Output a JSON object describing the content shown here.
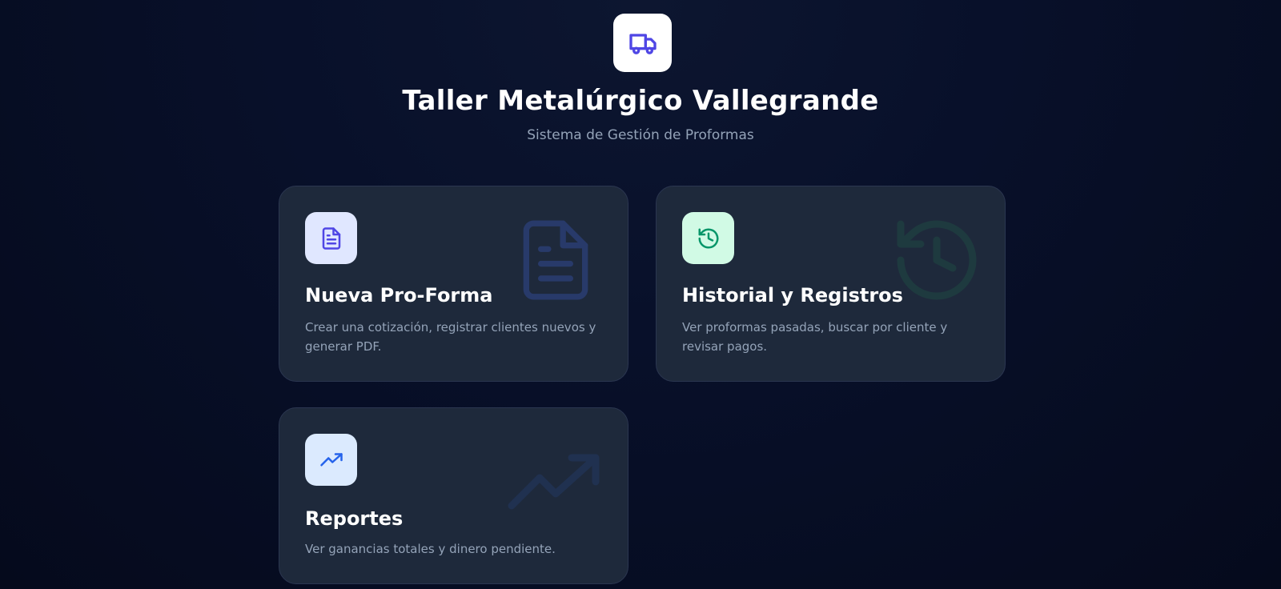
{
  "header": {
    "logo_icon": "truck-icon",
    "title": "Taller Metalúrgico Vallegrande",
    "subtitle": "Sistema de Gestión de Proformas"
  },
  "cards": [
    {
      "title": "Nueva Pro-Forma",
      "description": "Crear una cotización, registrar clientes nuevos y generar PDF.",
      "icon": "file-text-icon",
      "accent": "#4f46e5"
    },
    {
      "title": "Historial y Registros",
      "description": "Ver proformas pasadas, buscar por cliente y revisar pagos.",
      "icon": "history-icon",
      "accent": "#059669"
    },
    {
      "title": "Reportes",
      "description": "Ver ganancias totales y dinero pendiente.",
      "icon": "trending-up-icon",
      "accent": "#2563eb"
    }
  ]
}
